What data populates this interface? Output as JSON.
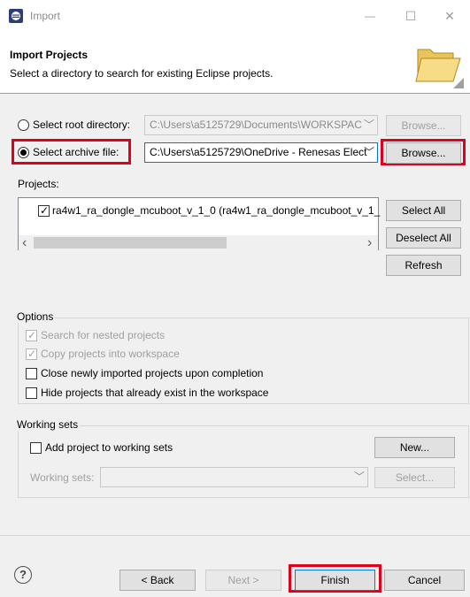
{
  "window": {
    "title": "Import",
    "minimize_glyph": "—",
    "maximize_glyph": "☐",
    "close_glyph": "✕",
    "app_icon": "eclipse-icon"
  },
  "header": {
    "title": "Import Projects",
    "description": "Select a directory to search for existing Eclipse projects.",
    "icon": "folder-icon"
  },
  "source": {
    "root_directory_label": "Select root directory:",
    "root_directory_value": "C:\\Users\\a5125729\\Documents\\WORKSPAC",
    "root_directory_selected": false,
    "archive_file_label": "Select archive file:",
    "archive_file_value": "C:\\Users\\a5125729\\OneDrive - Renesas Elect",
    "archive_file_selected": true,
    "browse_label": "Browse..."
  },
  "projects": {
    "label": "Projects:",
    "items": [
      {
        "label": "ra4w1_ra_dongle_mcuboot_v_1_0 (ra4w1_ra_dongle_mcuboot_v_1_",
        "checked": true
      }
    ],
    "select_all_label": "Select All",
    "deselect_all_label": "Deselect All",
    "refresh_label": "Refresh",
    "scroll_left_glyph": "‹",
    "scroll_right_glyph": "›"
  },
  "options": {
    "title": "Options",
    "items": [
      {
        "label": "Search for nested projects",
        "checked": true,
        "enabled": false
      },
      {
        "label": "Copy projects into workspace",
        "checked": true,
        "enabled": false
      },
      {
        "label": "Close newly imported projects upon completion",
        "checked": false,
        "enabled": true
      },
      {
        "label": "Hide projects that already exist in the workspace",
        "checked": false,
        "enabled": true
      }
    ]
  },
  "working_sets": {
    "title": "Working sets",
    "add_label": "Add project to working sets",
    "add_checked": false,
    "new_label": "New...",
    "sets_label": "Working sets:",
    "sets_value": "",
    "select_label": "Select..."
  },
  "footer": {
    "help_glyph": "?",
    "back_label": "< Back",
    "next_label": "Next >",
    "finish_label": "Finish",
    "cancel_label": "Cancel"
  },
  "colors": {
    "highlight": "#e0001b",
    "default_button_border": "#0078d7",
    "dialog_bg": "#f0f0f0"
  }
}
